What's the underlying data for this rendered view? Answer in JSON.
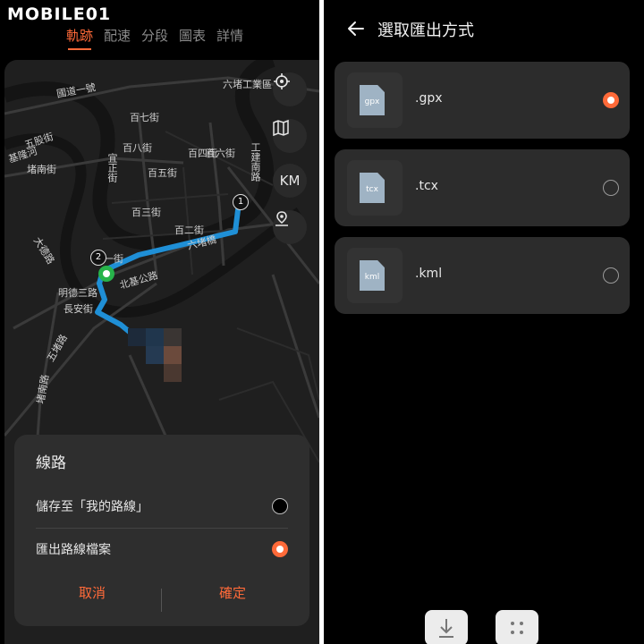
{
  "watermark": "MOBILE01",
  "tabs": [
    {
      "label": "軌跡",
      "active": true
    },
    {
      "label": "配速"
    },
    {
      "label": "分段"
    },
    {
      "label": "圖表"
    },
    {
      "label": "詳情"
    }
  ],
  "map": {
    "labels": [
      "六堵工業區",
      "國道一號",
      "基隆河",
      "五股街",
      "百七街",
      "百八街",
      "百五街",
      "百三街",
      "百二街",
      "百四街",
      "百一街",
      "百六街",
      "工建南路",
      "六堵橋",
      "堵南街",
      "大德路",
      "北基公路",
      "明德三路",
      "長安街",
      "五堵路",
      "堵南路",
      "宜正街"
    ],
    "markers": [
      "1",
      "2"
    ],
    "controls": {
      "unit": "KM"
    }
  },
  "route_sheet": {
    "title": "線路",
    "options": [
      {
        "label": "儲存至「我的路線」",
        "selected": false
      },
      {
        "label": "匯出路線檔案",
        "selected": true
      }
    ],
    "cancel": "取消",
    "confirm": "確定"
  },
  "export": {
    "title": "選取匯出方式",
    "formats": [
      {
        "icon_text": "gpx",
        "label": ".gpx",
        "selected": true
      },
      {
        "icon_text": "tcx",
        "label": ".tcx",
        "selected": false
      },
      {
        "icon_text": "kml",
        "label": ".kml",
        "selected": false
      }
    ]
  },
  "colors": {
    "accent": "#ff6a39",
    "route": "#1f8fd6",
    "background": "#000000",
    "card": "#2c2c2c"
  },
  "icons": [
    "back-arrow-icon",
    "locate-icon",
    "map-layers-icon",
    "route-pin-icon",
    "download-icon",
    "more-dots-icon",
    "file-icon"
  ]
}
